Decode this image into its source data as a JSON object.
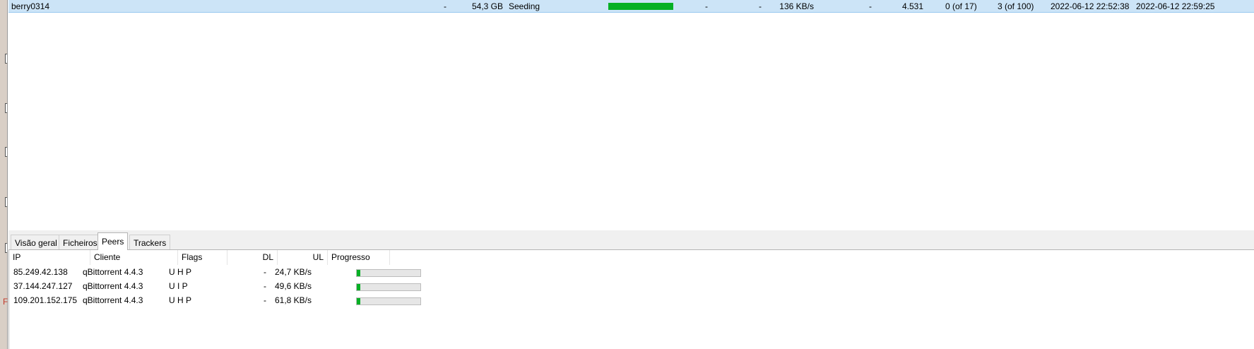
{
  "torrent": {
    "name": "berry0314",
    "dash1": "-",
    "size": "54,3 GB",
    "status": "Seeding",
    "progress": 1.0,
    "dash2": "-",
    "dash3": "-",
    "upload_speed": "136 KB/s",
    "dash4": "-",
    "ratio": "4.531",
    "seeds": "0 (of 17)",
    "peers": "3 (of 100)",
    "added_on": "2022-06-12 22:52:38",
    "completed_on": "2022-06-12 22:59:25",
    "progress_color": "#06b025",
    "selected_row_color": "#cce4f7"
  },
  "tabs": [
    {
      "label": "Visão geral"
    },
    {
      "label": "Ficheiros"
    },
    {
      "label": "Peers",
      "active": true
    },
    {
      "label": "Trackers"
    }
  ],
  "peers_table": {
    "headers": {
      "ip": "IP",
      "client": "Cliente",
      "flags": "Flags",
      "dl": "DL",
      "ul": "UL",
      "progress": "Progresso"
    },
    "rows": [
      {
        "ip": "85.249.42.138",
        "client": "qBittorrent 4.4.3",
        "flags": "U H P",
        "dl": "-",
        "ul": "24,7 KB/s",
        "progress": 0.05
      },
      {
        "ip": "37.144.247.127",
        "client": "qBittorrent 4.4.3",
        "flags": "U I P",
        "dl": "-",
        "ul": "49,6 KB/s",
        "progress": 0.05
      },
      {
        "ip": "109.201.152.175",
        "client": "qBittorrent 4.4.3",
        "flags": "U H P",
        "dl": "-",
        "ul": "61,8 KB/s",
        "progress": 0.05
      }
    ]
  },
  "left_edge": {
    "letter": "F"
  }
}
